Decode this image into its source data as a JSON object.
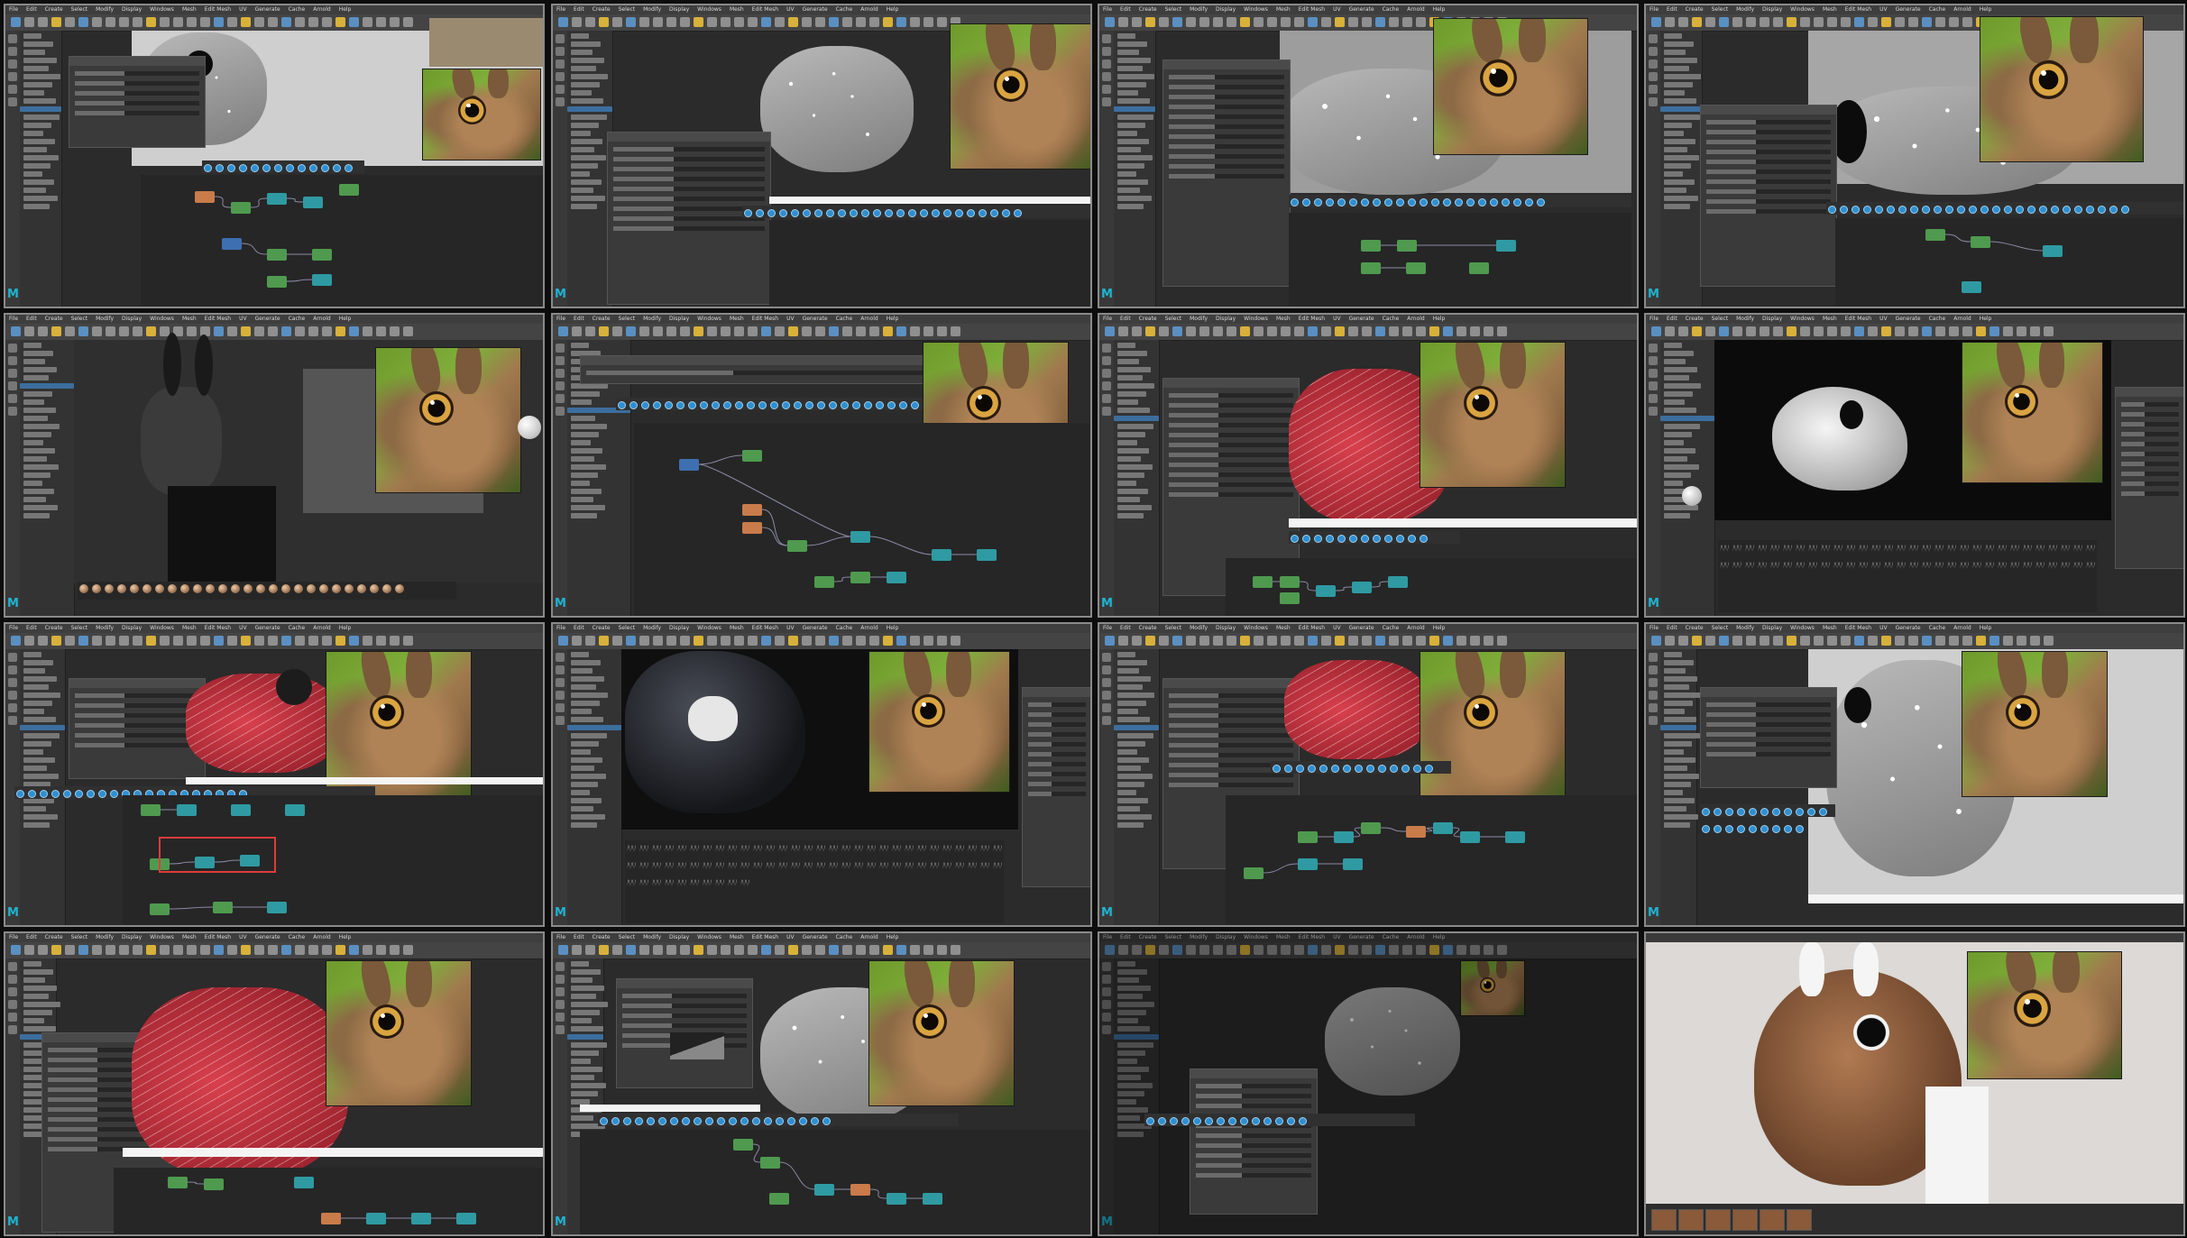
{
  "sheet": {
    "rows": 4,
    "columns": 4,
    "background_color": "#0d0d0d",
    "frame_border_color": "#8a8a8a"
  },
  "app": {
    "logo_glyph": "M",
    "logo_color": "#1fb3d1",
    "menu_items": [
      "File",
      "Edit",
      "Create",
      "Select",
      "Modify",
      "Display",
      "Windows",
      "Mesh",
      "Edit Mesh",
      "UV",
      "Generate",
      "Cache",
      "Arnold",
      "Help"
    ]
  },
  "thumbnails": [
    {
      "scene": "grey-mesh-eye-closeup",
      "has_reference_photo": true,
      "has_node_graph": true
    },
    {
      "scene": "grey-mesh-guides-side",
      "has_reference_photo": true,
      "has_node_graph": true
    },
    {
      "scene": "grey-mesh-guides-closeup",
      "has_reference_photo": true,
      "has_node_graph": true
    },
    {
      "scene": "grey-mesh-guides-attribute-editor",
      "has_reference_photo": true,
      "has_node_graph": true
    },
    {
      "scene": "silhouette-matte-and-material-balls",
      "has_reference_photo": true,
      "has_node_graph": false
    },
    {
      "scene": "node-graph-editor",
      "has_reference_photo": true,
      "has_node_graph": true
    },
    {
      "scene": "red-density-map-with-curves",
      "has_reference_photo": true,
      "has_node_graph": true
    },
    {
      "scene": "white-head-sculpt-brushes",
      "has_reference_photo": true,
      "has_node_graph": false
    },
    {
      "scene": "red-density-map-selected-nodes",
      "has_reference_photo": true,
      "has_node_graph": true
    },
    {
      "scene": "dark-head-sculpt-brushes",
      "has_reference_photo": true,
      "has_node_graph": false
    },
    {
      "scene": "red-density-map-attribute-panel",
      "has_reference_photo": true,
      "has_node_graph": true
    },
    {
      "scene": "grey-body-guides-full",
      "has_reference_photo": true,
      "has_node_graph": false
    },
    {
      "scene": "red-body-curves-panel",
      "has_reference_photo": true,
      "has_node_graph": true
    },
    {
      "scene": "grey-body-curve-ramp",
      "has_reference_photo": true,
      "has_node_graph": true
    },
    {
      "scene": "grey-neck-dimmed-panel",
      "has_reference_photo": true,
      "has_node_graph": false
    },
    {
      "scene": "final-fur-render",
      "has_reference_photo": true,
      "has_node_graph": false
    }
  ],
  "colors": {
    "ui_dark": "#2b2b2b",
    "node_green": "#4f9a4f",
    "node_teal": "#2f9aa2",
    "node_orange": "#c97b4a",
    "selection_blue": "#3c6e9e",
    "selection_box_red": "#e03b3b",
    "render_fur_brown": "#8a5a3a"
  }
}
